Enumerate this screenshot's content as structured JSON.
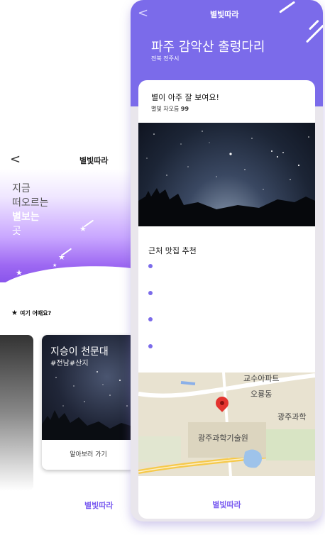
{
  "back_screen": {
    "back_arrow": "<",
    "app_title": "별빛따라",
    "hero_lines": [
      "지금",
      "떠오르는",
      "별보는",
      "곳"
    ],
    "question": "여기 어때요?",
    "card": {
      "title": "지승이 천문대",
      "tags": "#전남#산지",
      "button_label": "알아보러 가기"
    },
    "footer_title": "별빛따라"
  },
  "front_screen": {
    "back_arrow": "<",
    "app_title": "별빛따라",
    "place_name": "파주 감악산 출렁다리",
    "place_region": "전북 전주시",
    "review": {
      "text": "별이 아주 잘 보여요!",
      "rating_label": "별빛 차오름",
      "rating_value": "99"
    },
    "nearby": {
      "title": "근처 맛집 추천",
      "items": [
        "",
        "",
        "",
        ""
      ]
    },
    "map": {
      "labels": [
        "교수아파트",
        "오룡동",
        "광주과학",
        "광주과학기술원"
      ]
    },
    "footer_title": "별빛따라"
  },
  "colors": {
    "accent": "#7b6bea",
    "footer_text": "#7a5cf0",
    "pin": "#e3342f"
  },
  "icons": [
    "back-arrow-icon",
    "star-icon",
    "shooting-star-icon",
    "map-pin-icon"
  ]
}
